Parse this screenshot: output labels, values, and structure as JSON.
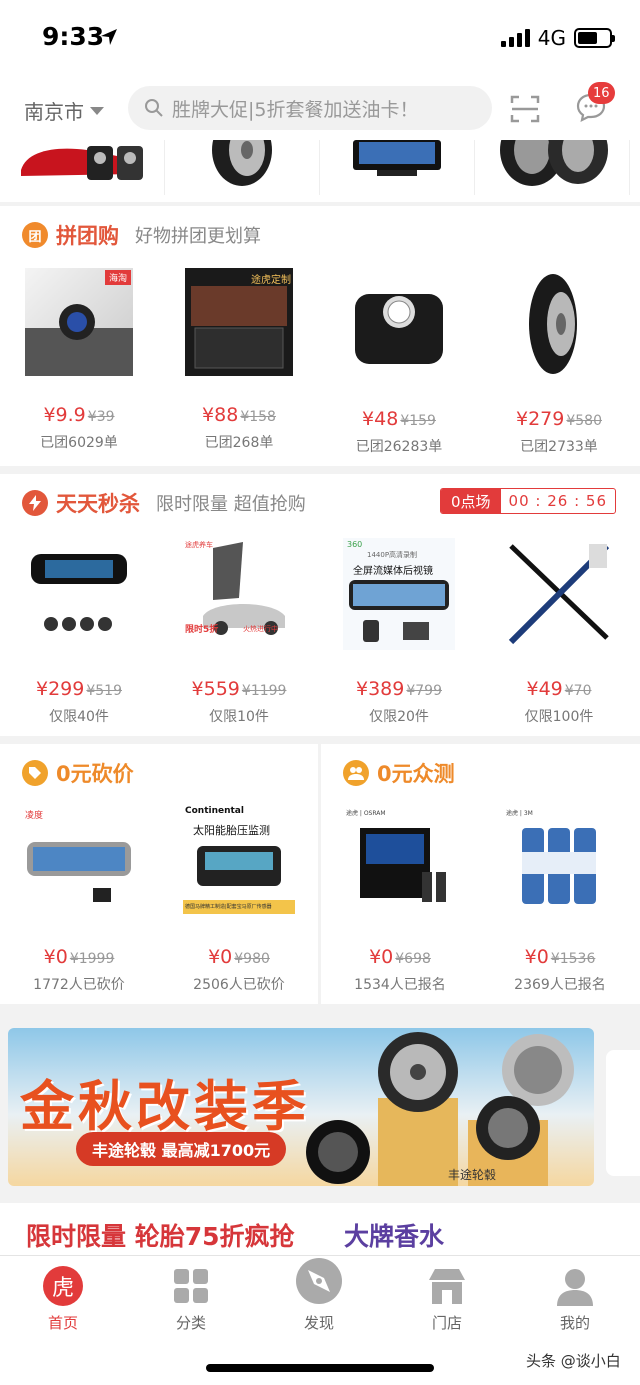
{
  "status_bar": {
    "time": "9:33",
    "network": "4G"
  },
  "header": {
    "city": "南京市",
    "search_placeholder": "胜牌大促|5折套餐加送油卡！",
    "message_badge": "16"
  },
  "group_buy": {
    "icon_char": "团",
    "title": "拼团购",
    "subtitle": "好物拼团更划算",
    "items": [
      {
        "price": "¥9.9",
        "orig": "¥39",
        "note": "已团6029单",
        "tag": "海淘"
      },
      {
        "price": "¥88",
        "orig": "¥158",
        "note": "已团268单",
        "tag": "途虎定制"
      },
      {
        "price": "¥48",
        "orig": "¥159",
        "note": "已团26283单"
      },
      {
        "price": "¥279",
        "orig": "¥580",
        "note": "已团2733单"
      }
    ]
  },
  "flash_sale": {
    "title": "天天秒杀",
    "subtitle": "限时限量 超值抢购",
    "session": "0点场",
    "countdown": "00 : 26 : 56",
    "items": [
      {
        "price": "¥299",
        "orig": "¥519",
        "note": "仅限40件"
      },
      {
        "price": "¥559",
        "orig": "¥1199",
        "note": "仅限10件",
        "img_text_a": "途虎养车",
        "img_text_b": "限时5折",
        "img_text_c": "火热进行中"
      },
      {
        "price": "¥389",
        "orig": "¥799",
        "note": "仅限20件",
        "img_text_a": "360",
        "img_text_b": "1440P高清录制",
        "img_text_c": "全屏流媒体后视镜"
      },
      {
        "price": "¥49",
        "orig": "¥70",
        "note": "仅限100件"
      }
    ]
  },
  "bargain": {
    "title": "0元砍价",
    "items": [
      {
        "price": "¥0",
        "orig": "¥1999",
        "note": "1772人已砍价",
        "img_brand": "凌度"
      },
      {
        "price": "¥0",
        "orig": "¥980",
        "note": "2506人已砍价",
        "img_brand": "Continental",
        "img_text": "太阳能胎压监测",
        "img_footer": "德国马牌精工制造|配套宝马原厂传感器"
      }
    ]
  },
  "trial": {
    "title": "0元众测",
    "items": [
      {
        "price": "¥0",
        "orig": "¥698",
        "note": "1534人已报名",
        "img_brand": "途虎 | OSRAM"
      },
      {
        "price": "¥0",
        "orig": "¥1536",
        "note": "2369人已报名",
        "img_brand": "途虎 | 3M"
      }
    ]
  },
  "banner": {
    "title": "金秋改装季",
    "subtitle": "丰途轮毂  最高减1700元",
    "brand": "丰途轮毂"
  },
  "promo": {
    "left": "限时限量 轮胎75折疯抢",
    "right": "大牌香水"
  },
  "tabs": [
    {
      "label": "首页",
      "icon": "home-tiger-icon"
    },
    {
      "label": "分类",
      "icon": "grid-icon"
    },
    {
      "label": "发现",
      "icon": "compass-icon"
    },
    {
      "label": "门店",
      "icon": "store-icon"
    },
    {
      "label": "我的",
      "icon": "user-icon"
    }
  ],
  "tab_home_char": "虎",
  "watermark": "头条 @谈小白",
  "colors": {
    "accent": "#e23b3b",
    "orange": "#f08a2c",
    "purple": "#5b3fa0"
  }
}
